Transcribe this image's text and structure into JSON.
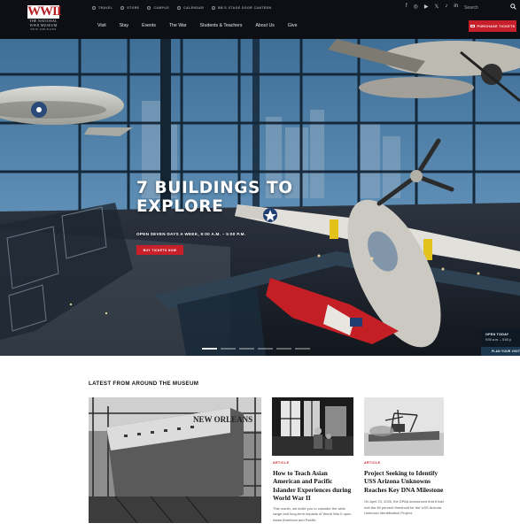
{
  "header": {
    "logo": {
      "mark": "WWII",
      "line1": "THE NATIONAL",
      "line2": "WWII MUSEUM",
      "line3": "NEW ORLEANS"
    },
    "utility_links": [
      {
        "label": "TRAVEL"
      },
      {
        "label": "STORE"
      },
      {
        "label": "CAMPUS"
      },
      {
        "label": "CALENDAR"
      },
      {
        "label": "BB'S STAGE DOOR CANTEEN"
      }
    ],
    "social": [
      "f",
      "◎",
      "▶",
      "𝕏",
      "♪",
      "in"
    ],
    "search": {
      "placeholder": "Search"
    },
    "nav": [
      "Visit",
      "Stay",
      "Events",
      "The War",
      "Students & Teachers",
      "About Us",
      "Give"
    ],
    "ticket_button": "PURCHASE TICKETS"
  },
  "hero": {
    "title_line1": "7 BUILDINGS TO",
    "title_line2": "EXPLORE",
    "subtitle": "OPEN SEVEN DAYS A WEEK, 9:00 A.M. – 5:00 P.M.",
    "button": "BUY TICKETS NOW",
    "slides": 6,
    "active_slide": 0
  },
  "hours": {
    "label": "OPEN TODAY",
    "value": "9:00 a.m. – 5:00 p",
    "link": "PLAN YOUR VISIT"
  },
  "news": {
    "title": "LATEST FROM AROUND THE MUSEUM",
    "feature_caption": "NEW ORLEANS",
    "cards": [
      {
        "kicker": "ARTICLE",
        "title": "How to Teach Asian American and Pacific Islander Experiences during World War II",
        "excerpt": "This month, we invite you to consider the wide range and long-term impacts of World War II upon Asian American and Pacific"
      },
      {
        "kicker": "ARTICLE",
        "title": "Project Seeking to Identify USS Arizona Unknowns Reaches Key DNA Milestone",
        "excerpt": "On April 23, 2026, the DPAA announced that it had met the 60 percent threshold for the USS Arizona Unknown Identification Project."
      }
    ]
  },
  "colors": {
    "accent_red": "#c8202a",
    "header_bg": "#0d0f14",
    "hours_bg": "#0d1a24"
  }
}
